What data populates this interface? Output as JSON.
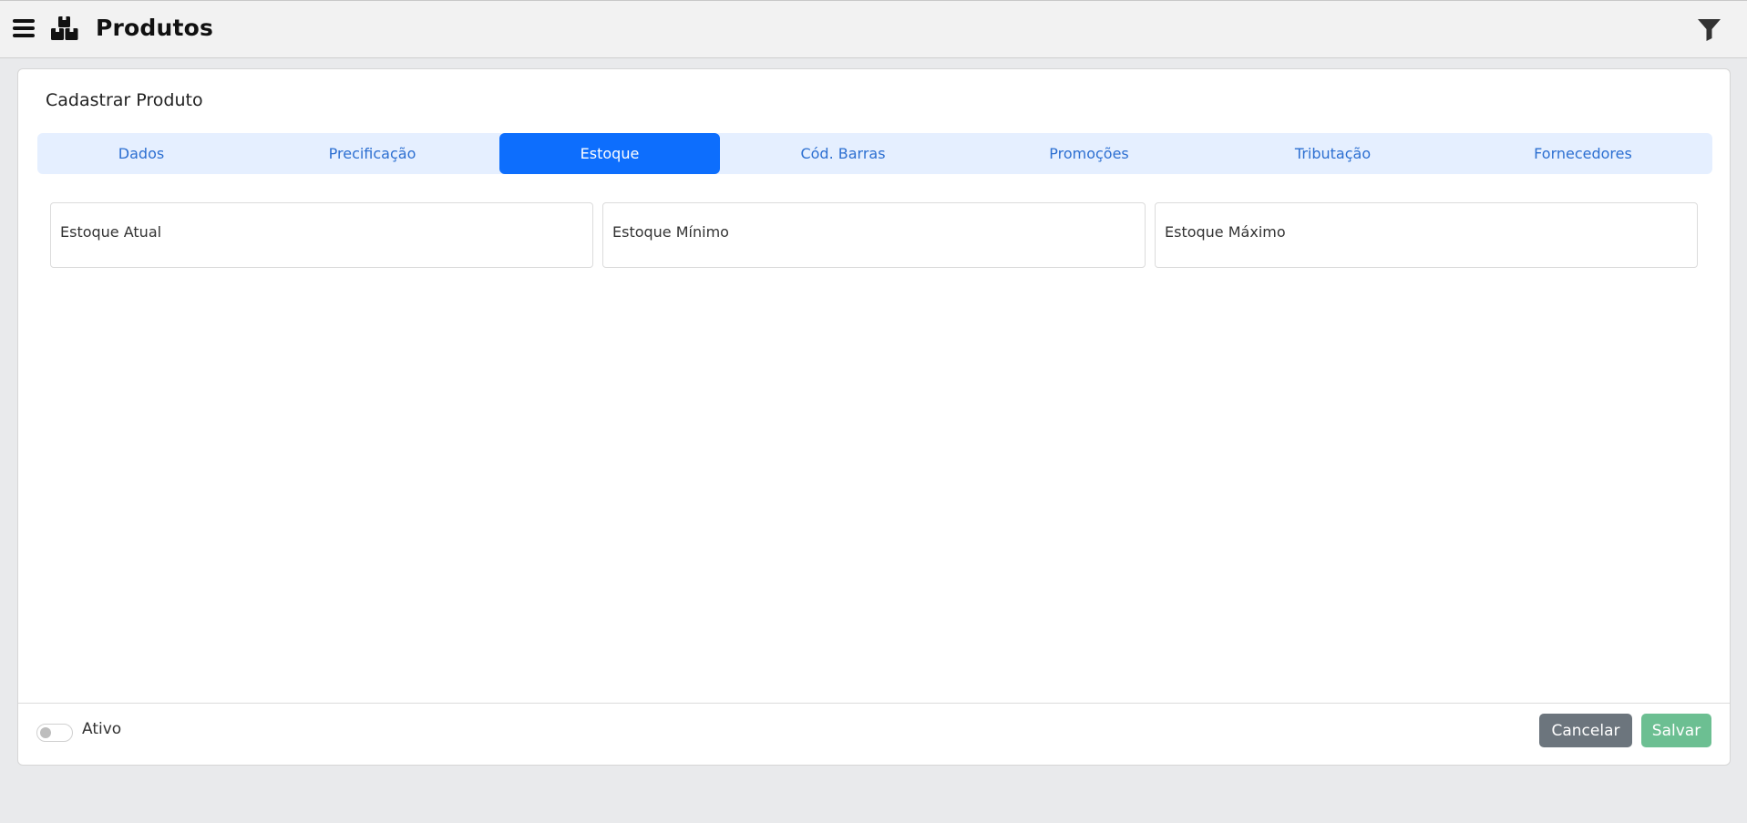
{
  "header": {
    "title": "Produtos",
    "menu_icon": "hamburger-menu-icon",
    "app_icon": "boxes-icon",
    "filter_icon": "filter-icon"
  },
  "card": {
    "title": "Cadastrar Produto"
  },
  "tabs": [
    {
      "label": "Dados",
      "active": false
    },
    {
      "label": "Precificação",
      "active": false
    },
    {
      "label": "Estoque",
      "active": true
    },
    {
      "label": "Cód. Barras",
      "active": false
    },
    {
      "label": "Promoções",
      "active": false
    },
    {
      "label": "Tributação",
      "active": false
    },
    {
      "label": "Fornecedores",
      "active": false
    }
  ],
  "fields": [
    {
      "label": "Estoque Atual",
      "value": ""
    },
    {
      "label": "Estoque Mínimo",
      "value": ""
    },
    {
      "label": "Estoque Máximo",
      "value": ""
    }
  ],
  "footer": {
    "active_label": "Ativo",
    "active_on": false,
    "cancel_label": "Cancelar",
    "save_label": "Salvar"
  },
  "colors": {
    "primary": "#0d6efd",
    "tab_bar": "#e5efff",
    "cancel": "#6c757d",
    "save": "#6cbf92"
  }
}
